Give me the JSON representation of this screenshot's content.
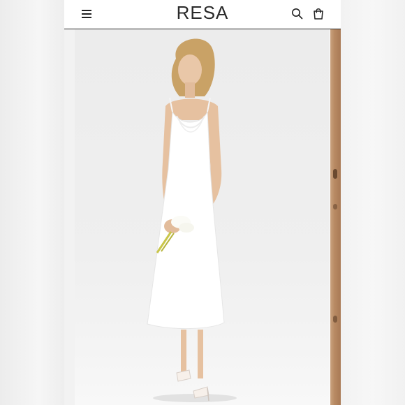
{
  "header": {
    "brand": "RESA",
    "menu_icon": "hamburger-menu-icon",
    "search_icon": "search-icon",
    "cart_icon": "shopping-bag-icon"
  },
  "gallery": {
    "main_image": "model-in-white-cowl-neck-slip-dress-holding-calla-lilies",
    "next_image": "partial-next-product-photo"
  },
  "colors": {
    "header_bg": "#ffffff",
    "text": "#2a2a2a",
    "divider": "#2a2a2a",
    "photo_bg": "#efefef"
  }
}
